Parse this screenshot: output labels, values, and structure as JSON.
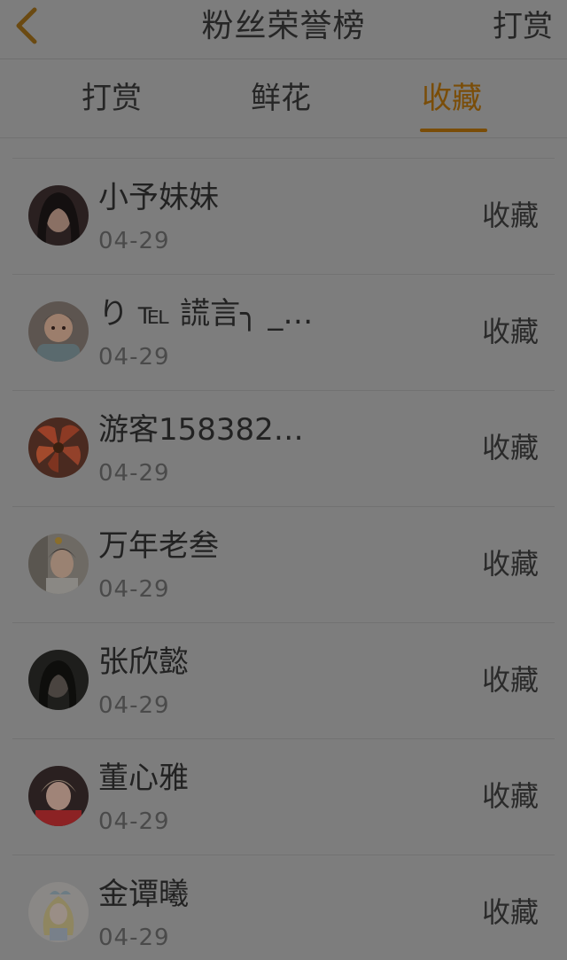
{
  "header": {
    "title": "粉丝荣誉榜",
    "action_label": "打赏"
  },
  "tabs": [
    {
      "label": "打赏",
      "active": false
    },
    {
      "label": "鲜花",
      "active": false
    },
    {
      "label": "收藏",
      "active": true
    }
  ],
  "colors": {
    "accent": "#7a4d08",
    "overlay_bg": "#7d7d7d"
  },
  "fans": [
    {
      "name": "小予妹妹",
      "date": "04-29",
      "action": "收藏"
    },
    {
      "name": "り ℡ 謊言╮ _…",
      "date": "04-29",
      "action": "收藏"
    },
    {
      "name": "游客158382…",
      "date": "04-29",
      "action": "收藏"
    },
    {
      "name": "万年老叁",
      "date": "04-29",
      "action": "收藏"
    },
    {
      "name": "张欣懿",
      "date": "04-29",
      "action": "收藏"
    },
    {
      "name": "董心雅",
      "date": "04-29",
      "action": "收藏"
    },
    {
      "name": "金谭曦",
      "date": "04-29",
      "action": "收藏"
    }
  ]
}
